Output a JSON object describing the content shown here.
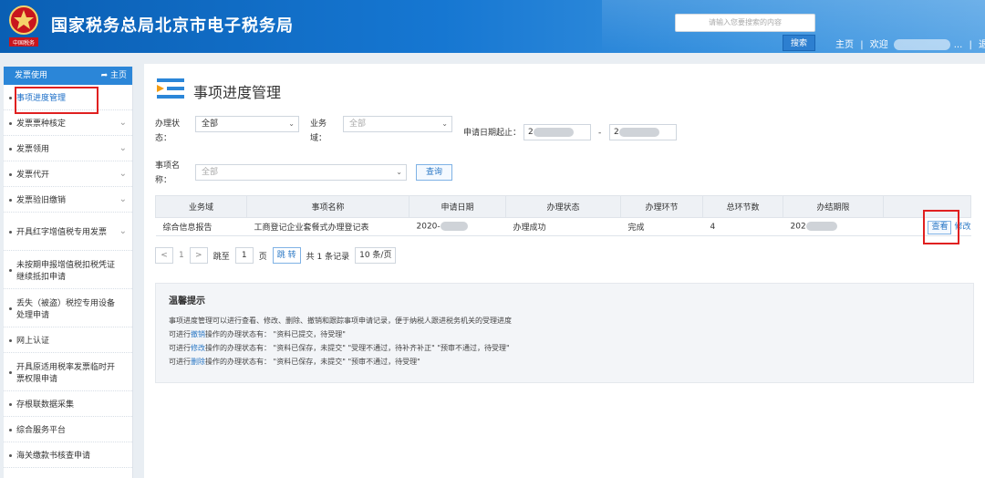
{
  "header": {
    "site_title": "国家税务总局北京市电子税务局",
    "emblem_text": "中国税务",
    "search_placeholder": "请输入您要搜索的内容",
    "search_button": "搜索",
    "home_link": "主页",
    "welcome_prefix": "欢迎",
    "welcome_suffix": "...",
    "logout": "退出",
    "separator": "|"
  },
  "sidebar": {
    "title": "发票使用",
    "home": "主页",
    "items": [
      {
        "label": "事项进度管理",
        "chevron": false
      },
      {
        "label": "发票票种核定",
        "chevron": true
      },
      {
        "label": "发票领用",
        "chevron": true
      },
      {
        "label": "发票代开",
        "chevron": true
      },
      {
        "label": "发票验旧缴销",
        "chevron": true
      },
      {
        "label": "开具红字增值税专用发票",
        "chevron": true
      },
      {
        "label": "未按期申报增值税扣税凭证继续抵扣申请",
        "chevron": false
      },
      {
        "label": "丢失（被盗）税控专用设备处理申请",
        "chevron": false
      },
      {
        "label": "网上认证",
        "chevron": false
      },
      {
        "label": "开具原适用税率发票临时开票权限申请",
        "chevron": false
      },
      {
        "label": "存根联数据采集",
        "chevron": false
      },
      {
        "label": "综合服务平台",
        "chevron": false
      },
      {
        "label": "海关缴款书核查申请",
        "chevron": false
      }
    ]
  },
  "main": {
    "page_title": "事项进度管理",
    "filters": {
      "status_label": "办理状态：",
      "status_value": "全部",
      "domain_label": "业务域：",
      "domain_placeholder": "全部",
      "date_label": "申请日期起止：",
      "date_start": "2",
      "date_sep": "-",
      "date_end": "2",
      "item_label": "事项名称：",
      "item_placeholder": "全部",
      "query_button": "查询"
    },
    "table": {
      "columns": [
        "业务域",
        "事项名称",
        "申请日期",
        "办理状态",
        "办理环节",
        "总环节数",
        "办结期限",
        ""
      ],
      "rows": [
        {
          "domain": "综合信息报告",
          "name": "工商登记企业套餐式办理登记表",
          "date": "2020-",
          "status": "办理成功",
          "step": "完成",
          "total_steps": "4",
          "deadline": "202",
          "view": "查看",
          "edit": "修改"
        }
      ]
    },
    "pager": {
      "prev": "<",
      "page": "1",
      "next": ">",
      "goto_label": "跳至",
      "goto_value": "1",
      "page_unit": "页",
      "goto_button": "跳 转",
      "total": "共 1 条记录",
      "page_size": "10 条/页"
    },
    "tips": {
      "title": "温馨提示",
      "line1": "事项进度管理可以进行查看、修改、删除、撤销和跟踪事项申请记录，便于纳税人跟进税务机关的受理进度",
      "line2_pre": "可进行",
      "line2_hl": "撤销",
      "line2_post": "操作的办理状态有：  \"资料已提交，待受理\"",
      "line3_pre": "可进行",
      "line3_hl": "修改",
      "line3_post": "操作的办理状态有：  \"资料已保存，未提交\"     \"受理不通过，待补齐补正\"     \"预审不通过，待受理\"",
      "line4_pre": "可进行",
      "line4_hl": "删除",
      "line4_post": "操作的办理状态有：  \"资料已保存，未提交\"     \"预审不通过，待受理\""
    }
  },
  "colors": {
    "header_blue": "#1677d2",
    "accent": "#2b78c5",
    "highlight_red": "#e02020"
  }
}
